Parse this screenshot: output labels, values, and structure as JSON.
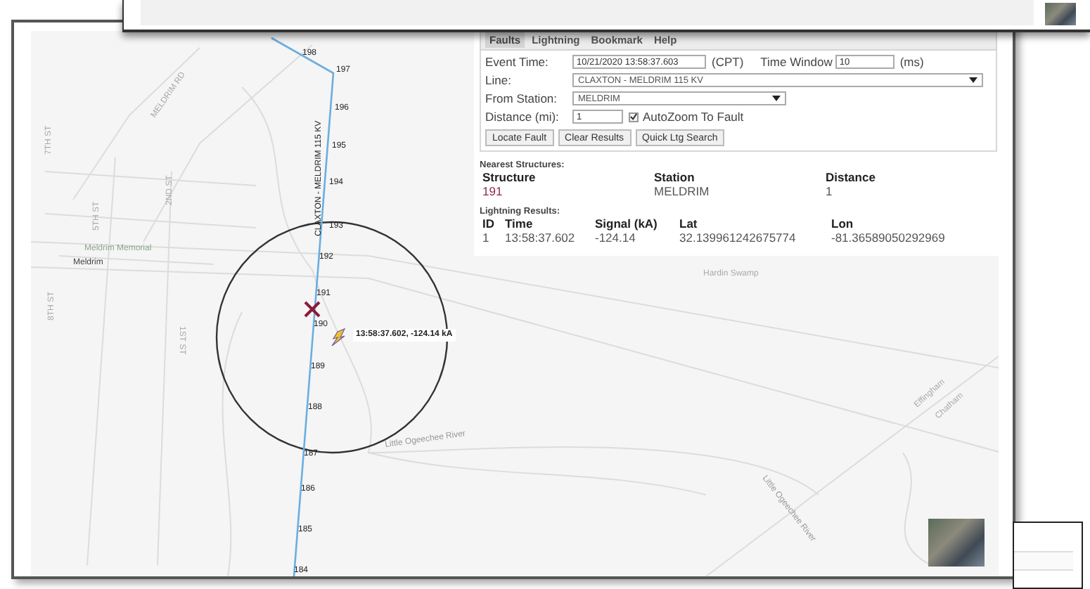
{
  "panel": {
    "tabs": [
      {
        "label": "Faults",
        "selected": true
      },
      {
        "label": "Lightning",
        "selected": false
      },
      {
        "label": "Bookmark",
        "selected": false
      },
      {
        "label": "Help",
        "selected": false
      }
    ],
    "form": {
      "event_time_label": "Event Time:",
      "event_time": "10/21/2020 13:58:37.603",
      "event_time_zone": "(CPT)",
      "time_window_label": "Time Window",
      "time_window": "10",
      "time_window_unit": "(ms)",
      "line_label": "Line:",
      "line": "CLAXTON - MELDRIM 115 KV",
      "from_station_label": "From Station:",
      "from_station": "MELDRIM",
      "distance_label": "Distance (mi):",
      "distance": "1",
      "autozoom": {
        "label": "AutoZoom To Fault",
        "checked": true
      }
    },
    "buttons": [
      "Locate Fault",
      "Clear Results",
      "Quick Ltg Search"
    ],
    "nearest_structures": {
      "title": "Nearest Structures:",
      "columns": [
        "Structure",
        "Station",
        "Distance"
      ],
      "rows": [
        [
          "191",
          "MELDRIM",
          "1"
        ]
      ]
    },
    "lightning_results": {
      "title": "Lightning Results:",
      "columns": [
        "ID",
        "Time",
        "Signal (kA)",
        "Lat",
        "Lon"
      ],
      "rows": [
        [
          "1",
          "13:58:37.602",
          "-124.14",
          "32.139961242675774",
          "-81.36589050292969"
        ]
      ]
    }
  },
  "map": {
    "line_label": "CLAXTON - MELDRIM 115 KV",
    "structures": [
      "198",
      "197",
      "196",
      "195",
      "194",
      "193",
      "192",
      "191",
      "190",
      "189",
      "188",
      "187",
      "186",
      "185",
      "184"
    ],
    "strike_label": "13:58:37.602, -124.14 kA",
    "place_labels": [
      "Meldrim Memorial",
      "Meldrim",
      "MELDRIM RD",
      "7TH ST",
      "5TH ST",
      "2ND ST",
      "1ST ST",
      "8TH ST",
      "Little Ogeechee River",
      "Hardin Swamp",
      "Effingham",
      "Chatham",
      "Little Ogeechee River"
    ]
  }
}
